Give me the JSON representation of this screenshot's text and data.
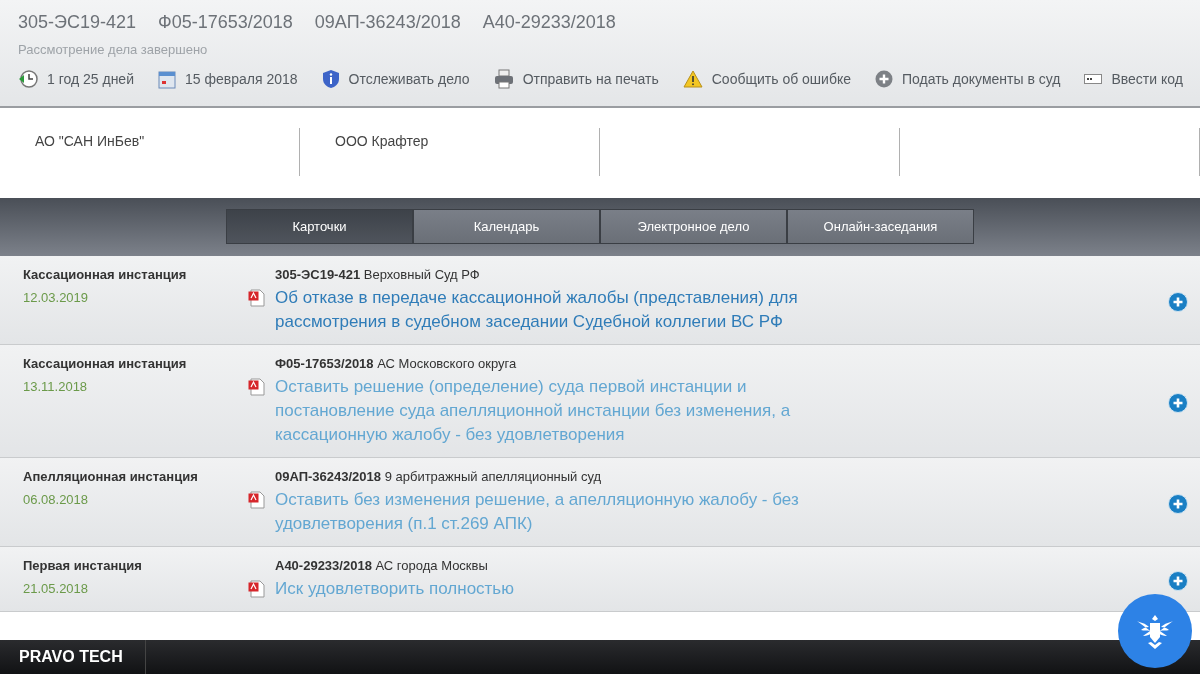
{
  "header": {
    "case_numbers": [
      "305-ЭС19-421",
      "Ф05-17653/2018",
      "09АП-36243/2018",
      "А40-29233/2018"
    ],
    "status": "Рассмотрение дела завершено",
    "actions": [
      {
        "kind": "clock",
        "label": "1 год 25 дней"
      },
      {
        "kind": "calendar",
        "label": "15 февраля 2018"
      },
      {
        "kind": "shield",
        "label": "Отслеживать дело"
      },
      {
        "kind": "printer",
        "label": "Отправить на печать"
      },
      {
        "kind": "warning",
        "label": "Сообщить об ошибке"
      },
      {
        "kind": "plus",
        "label": "Подать документы в суд"
      },
      {
        "kind": "code",
        "label": "Ввести код"
      }
    ]
  },
  "parties": [
    "АО \"САН ИнБев\"",
    "ООО Крафтер"
  ],
  "tabs": [
    {
      "label": "Карточки",
      "selected": true
    },
    {
      "label": "Календарь",
      "selected": false
    },
    {
      "label": "Электронное дело",
      "selected": false
    },
    {
      "label": "Онлайн-заседания",
      "selected": false
    }
  ],
  "instances": [
    {
      "instance": "Кассационная инстанция",
      "date": "12.03.2019",
      "number": "305-ЭС19-421",
      "court": "Верховный Суд РФ",
      "decision": "Об отказе в передаче кассационной жалобы (представления) для рассмотрения в судебном заседании Судебной коллегии ВС РФ",
      "highlighted": true
    },
    {
      "instance": "Кассационная инстанция",
      "date": "13.11.2018",
      "number": "Ф05-17653/2018",
      "court": "АС Московского округа",
      "decision": "Оставить решение (определение) суда первой инстанции и постановление суда апелляционной инстанции без изменения, а кассационную жалобу - без удовлетворения",
      "highlighted": false
    },
    {
      "instance": "Апелляционная инстанция",
      "date": "06.08.2018",
      "number": "09АП-36243/2018",
      "court": "9 арбитражный апелляционный суд",
      "decision": "Оставить без изменения решение, а апелляционную жалобу - без удовлетворения (п.1 ст.269 АПК)",
      "highlighted": false
    },
    {
      "instance": "Первая инстанция",
      "date": "21.05.2018",
      "number": "А40-29233/2018",
      "court": "АС города Москвы",
      "decision": "Иск удовлетворить полностью",
      "highlighted": false
    }
  ],
  "footer": {
    "brand": "PRAVO TECH"
  }
}
